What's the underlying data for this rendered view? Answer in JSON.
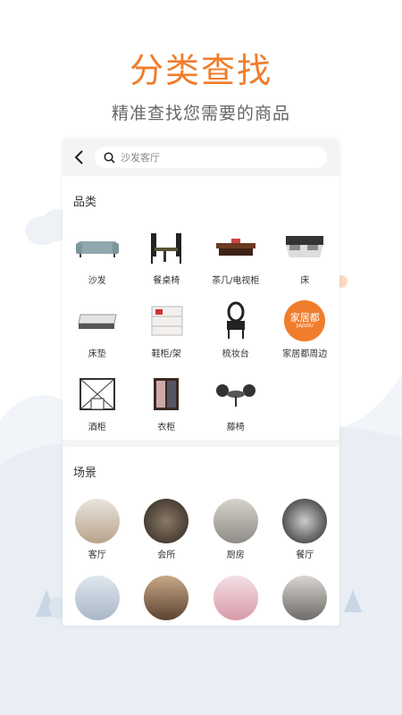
{
  "header": {
    "title": "分类查找",
    "subtitle": "精准查找您需要的商品"
  },
  "search": {
    "placeholder": "沙发客厅"
  },
  "categories": {
    "title": "品类",
    "items": [
      {
        "label": "沙发",
        "icon": "sofa-icon"
      },
      {
        "label": "餐桌椅",
        "icon": "dining-set-icon"
      },
      {
        "label": "茶几/电视柜",
        "icon": "tea-table-icon"
      },
      {
        "label": "床",
        "icon": "bed-icon"
      },
      {
        "label": "床垫",
        "icon": "mattress-icon"
      },
      {
        "label": "鞋柜/架",
        "icon": "shoe-cabinet-icon"
      },
      {
        "label": "梳妆台",
        "icon": "dresser-icon"
      },
      {
        "label": "家居都周边",
        "icon": "brand-badge-icon",
        "badge_text": "家居都",
        "badge_sub": "JIAJUDU"
      },
      {
        "label": "酒柜",
        "icon": "wine-cabinet-icon"
      },
      {
        "label": "衣柜",
        "icon": "wardrobe-icon"
      },
      {
        "label": "藤椅",
        "icon": "rattan-chair-icon"
      }
    ]
  },
  "scenes": {
    "title": "场景",
    "items": [
      {
        "label": "客厅",
        "icon": "living-room-photo"
      },
      {
        "label": "会所",
        "icon": "clubhouse-photo"
      },
      {
        "label": "厨房",
        "icon": "kitchen-photo"
      },
      {
        "label": "餐厅",
        "icon": "restaurant-photo"
      },
      {
        "label": "",
        "icon": "bedroom-photo"
      },
      {
        "label": "",
        "icon": "study-photo"
      },
      {
        "label": "",
        "icon": "kids-room-photo"
      },
      {
        "label": "",
        "icon": "dining-room-photo"
      }
    ]
  },
  "colors": {
    "accent": "#f07d2c",
    "text": "#333333",
    "muted": "#666666"
  }
}
